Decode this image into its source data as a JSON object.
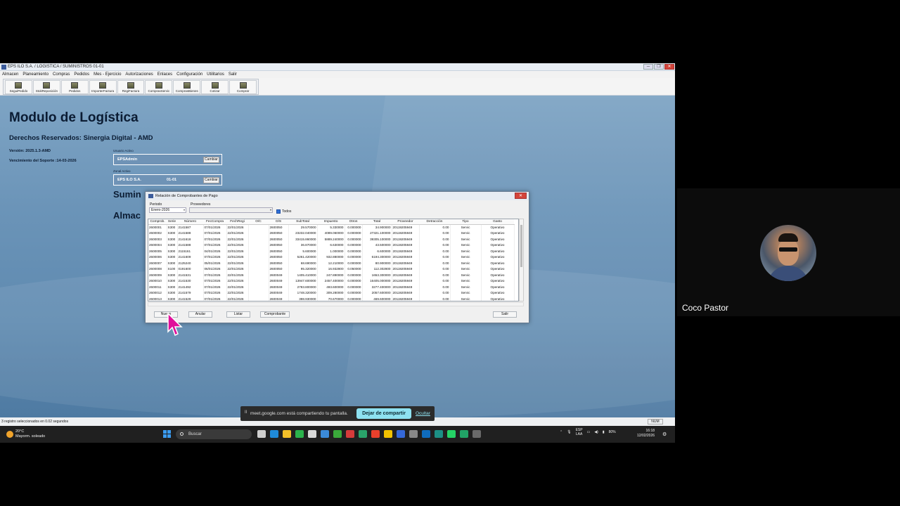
{
  "window": {
    "title": "EPS ILO  S.A. / LOGISTICA / SUMINISTROS 01-01",
    "buttons": [
      "─",
      "❐",
      "✕"
    ]
  },
  "menu": [
    "Almacen",
    "Planeamiento",
    "Compras",
    "Pedidos",
    "Mes - Ejercicio",
    "Autorizaciones",
    "Enlaces",
    "Configuración",
    "Utilitarios",
    "Salir"
  ],
  "toolbar": [
    "SeguiPedido",
    "StokReposición",
    "Pedidos",
    "ImporterFactura",
    "RegiFactura",
    "ComprasServic",
    "ComprasBienes",
    "Cotizar",
    "Comprar"
  ],
  "app": {
    "module_title": "Modulo de Logística",
    "rights": "Derechos Reservados:  Sinergia Digital - AMD",
    "version": "Versión: 2025.1.3-AMD",
    "support": "Vencimiento del Soporte :14-03-2026",
    "user_label": "Usuario Activo",
    "user_value": "EPSAdmin",
    "zone_label": "Zonal Activo",
    "zone_value": "EPS ILO S.A.",
    "zone_code": "01-01",
    "change_btn": "Cambiar",
    "sumin": "Sumin",
    "almac": "Almac"
  },
  "dialog": {
    "title": "Relación de Comprobantes de Pago",
    "close": "✕",
    "periodo_label": "Periodo",
    "periodo_value": "Enero-2026",
    "proveedores_label": "Proveedores",
    "todos": "Todos",
    "columns": [
      "Comprob.",
      "Serie",
      "Número",
      "FecCompra",
      "FechRegi",
      "O/C",
      "O/S",
      "SubTotal",
      "Impuesto",
      "Otros",
      "Total",
      "Proveedor",
      "Detracción",
      "Tipo",
      "Gasto"
    ],
    "rows": [
      [
        "2600001",
        "S300",
        "2141587",
        "07/01/2026",
        "22/01/2026",
        "",
        "2600050",
        "29.570000",
        "5.330000",
        "0.000000",
        "34.900000",
        "20119205949",
        "0.00",
        "Servic",
        "Operativo"
      ],
      [
        "2600002",
        "S300",
        "2141588",
        "07/01/2026",
        "22/01/2026",
        "",
        "2600050",
        "23232.040000",
        "4089.060000",
        "0.000000",
        "27321.100000",
        "20119205949",
        "0.00",
        "Servic",
        "Operativo"
      ],
      [
        "2600003",
        "S300",
        "2141618",
        "07/01/2026",
        "22/01/2026",
        "",
        "2600050",
        "33415.860000",
        "5889.240000",
        "0.000000",
        "39305.100000",
        "20119205949",
        "0.00",
        "Servic",
        "Operativo"
      ],
      [
        "2600004",
        "S300",
        "2141588",
        "07/01/2026",
        "22/01/2026",
        "",
        "2600050",
        "36.870000",
        "6.630000",
        "0.000000",
        "43.500000",
        "20119205949",
        "0.00",
        "Servic",
        "Operativo"
      ],
      [
        "2600005",
        "S300",
        "2115161",
        "04/01/2026",
        "22/01/2026",
        "",
        "2600050",
        "5.600000",
        "1.000000",
        "0.000000",
        "6.600000",
        "20119205949",
        "0.00",
        "Servic",
        "Operativo"
      ],
      [
        "2600006",
        "S300",
        "2141609",
        "07/01/2026",
        "22/01/2026",
        "",
        "2600050",
        "5261.420000",
        "932.880000",
        "0.000000",
        "6194.300000",
        "20119205949",
        "0.00",
        "Servic",
        "Operativo"
      ],
      [
        "2600007",
        "S300",
        "2125240",
        "05/01/2026",
        "22/01/2026",
        "",
        "2600050",
        "68.690000",
        "12.210000",
        "0.000000",
        "80.900000",
        "20119205949",
        "0.00",
        "Servic",
        "Operativo"
      ],
      [
        "2600008",
        "S100",
        "0191600",
        "06/01/2026",
        "22/01/2026",
        "",
        "2600050",
        "95.320000",
        "16.932800",
        "0.050000",
        "112.302800",
        "20119205949",
        "0.00",
        "Servic",
        "Operativo"
      ],
      [
        "2600009",
        "S300",
        "2141531",
        "07/01/2026",
        "22/01/2026",
        "",
        "2600049",
        "1405.410000",
        "247.890000",
        "0.000000",
        "1653.300000",
        "20119205949",
        "0.00",
        "Servic",
        "Operativo"
      ],
      [
        "2600010",
        "S300",
        "2141530",
        "07/01/2026",
        "22/01/2026",
        "",
        "2600049",
        "13947.600000",
        "2457.400000",
        "0.000000",
        "16405.000000",
        "20119205949",
        "0.00",
        "Servic",
        "Operativo"
      ],
      [
        "2600011",
        "S300",
        "2141492",
        "07/01/2026",
        "22/01/2026",
        "",
        "2600049",
        "2783.800000",
        "493.600000",
        "0.000000",
        "3277.400000",
        "20119205949",
        "0.00",
        "Servic",
        "Operativo"
      ],
      [
        "2600012",
        "S300",
        "2141579",
        "07/01/2026",
        "22/01/2026",
        "",
        "2600049",
        "1748.320000",
        "309.280000",
        "0.000000",
        "2057.600000",
        "20119205949",
        "0.00",
        "Servic",
        "Operativo"
      ],
      [
        "2600013",
        "S300",
        "2141529",
        "07/01/2026",
        "22/01/2026",
        "",
        "2600049",
        "398.930000",
        "70.670000",
        "0.000000",
        "469.600000",
        "20119205949",
        "0.00",
        "Servic",
        "Operativo"
      ]
    ],
    "btn_nuevo": "Nuevo",
    "btn_anular": "Anular",
    "btn_listar": "Listar",
    "btn_comprobante": "Comprobante",
    "btn_salir": "Salir"
  },
  "statusbar": {
    "text": "3 registro seleccionados en 0.02 segundos",
    "num": "NUM"
  },
  "share": {
    "pause": "II",
    "text": "meet.google.com está compartiendo tu pantalla.",
    "stop": "Dejar de compartir",
    "hide": "Ocultar"
  },
  "taskbar": {
    "temp": "20°C",
    "weather": "Mayorm. soleado",
    "search": "Buscar",
    "lang1": "ESP",
    "lang2": "LAA",
    "battery": "80%",
    "time": "16:18",
    "date": "12/02/2026",
    "icon_colors": [
      "#cfcfcf",
      "#1f8ad8",
      "#f3c029",
      "#2bb24c",
      "#d9d9d9",
      "#3b8ad9",
      "#3aa83a",
      "#d63b3b",
      "#2aa36a",
      "#e8402c",
      "#f2c200",
      "#3568d8",
      "#888888",
      "#0f6cbd",
      "#1c8f85",
      "#25d366",
      "#21a366",
      "#6a6a6a"
    ]
  },
  "participant": {
    "name": "Coco Pastor"
  }
}
